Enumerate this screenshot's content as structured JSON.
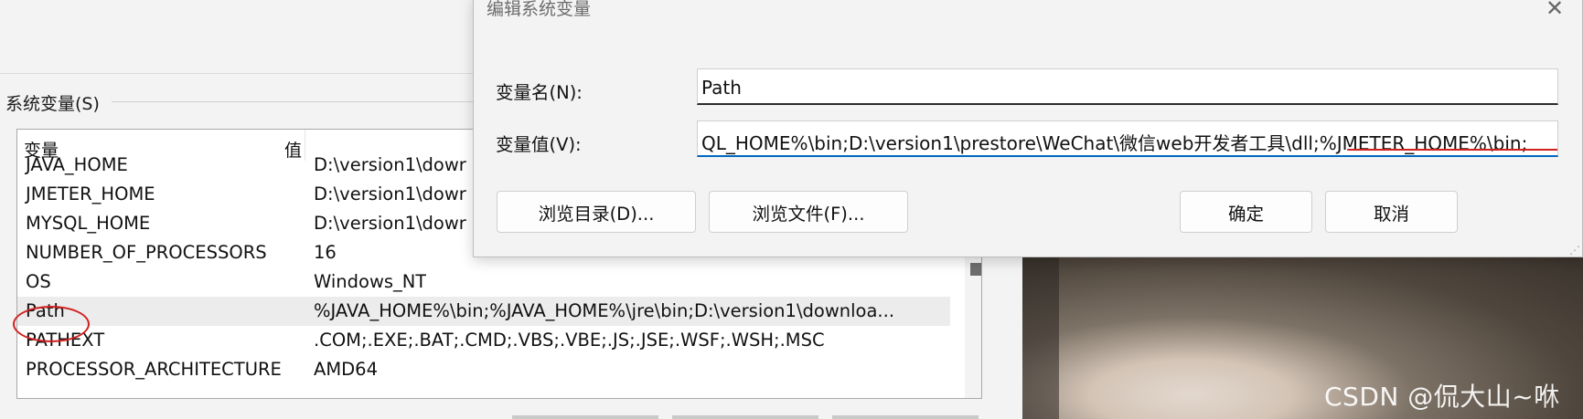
{
  "env_window": {
    "section_title": "系统变量(S)",
    "columns": {
      "name": "变量",
      "value": "值"
    },
    "rows": [
      {
        "name": "JAVA_HOME",
        "value": "D:\\version1\\dowr"
      },
      {
        "name": "JMETER_HOME",
        "value": "D:\\version1\\dowr"
      },
      {
        "name": "MYSQL_HOME",
        "value": "D:\\version1\\dowr"
      },
      {
        "name": "NUMBER_OF_PROCESSORS",
        "value": "16"
      },
      {
        "name": "OS",
        "value": "Windows_NT"
      },
      {
        "name": "Path",
        "value": "%JAVA_HOME%\\bin;%JAVA_HOME%\\jre\\bin;D:\\version1\\downloa..."
      },
      {
        "name": "PATHEXT",
        "value": ".COM;.EXE;.BAT;.CMD;.VBS;.VBE;.JS;.JSE;.WSF;.WSH;.MSC"
      },
      {
        "name": "PROCESSOR_ARCHITECTURE",
        "value": "AMD64"
      }
    ],
    "selected_row": "Path"
  },
  "dialog": {
    "title": "编辑系统变量",
    "close_glyph": "✕",
    "name_label": "变量名(N):",
    "name_value": "Path",
    "value_label": "变量值(V):",
    "value_text": "QL_HOME%\\bin;D:\\version1\\prestore\\WeChat\\微信web开发者工具\\dll;%JMETER_HOME%\\bin;",
    "browse_dir_label": "浏览目录(D)...",
    "browse_file_label": "浏览文件(F)...",
    "ok_label": "确定",
    "cancel_label": "取消"
  },
  "watermark": "CSDN @侃大山~咻",
  "annotation_color": "#d21f1f",
  "icons": {
    "close": "close-icon",
    "resize": "resize-grip-icon"
  }
}
